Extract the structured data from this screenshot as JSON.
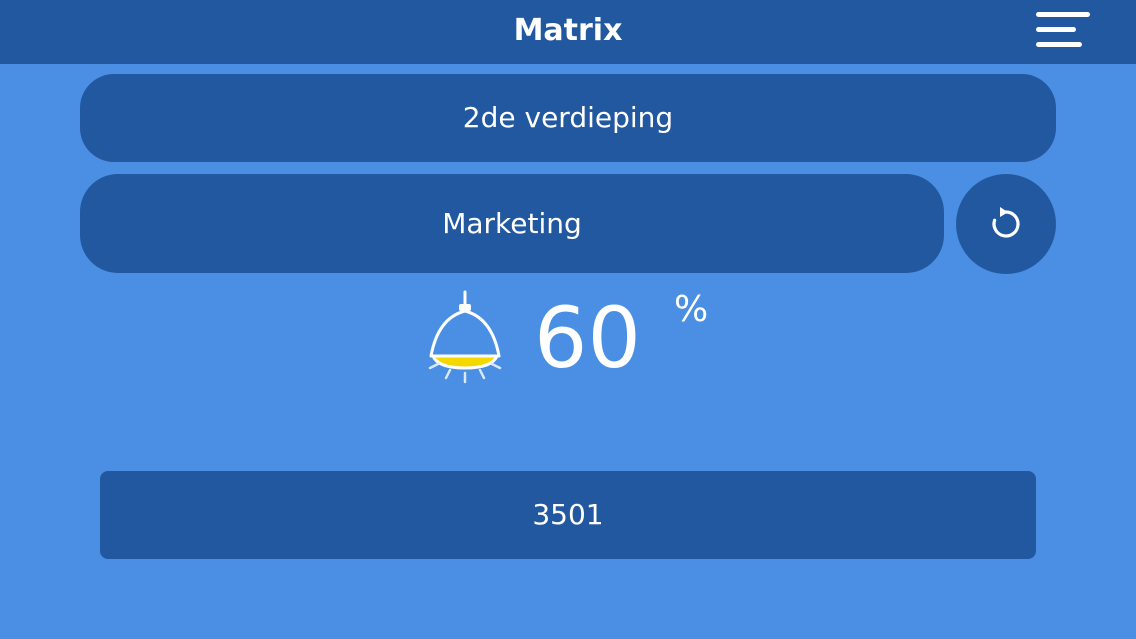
{
  "header": {
    "title": "Matrix",
    "menu_icon": "hamburger-menu-icon"
  },
  "selectors": {
    "floor": "2de verdieping",
    "group": "Marketing",
    "refresh_icon": "refresh-icon"
  },
  "light": {
    "icon": "lamp-icon",
    "level": "60",
    "unit": "%",
    "level_fraction": 0.6
  },
  "device": {
    "id": "3501"
  },
  "colors": {
    "background": "#4a8fe3",
    "bar": "#22589f",
    "lamp_light": "#f5d800",
    "text": "#ffffff"
  }
}
